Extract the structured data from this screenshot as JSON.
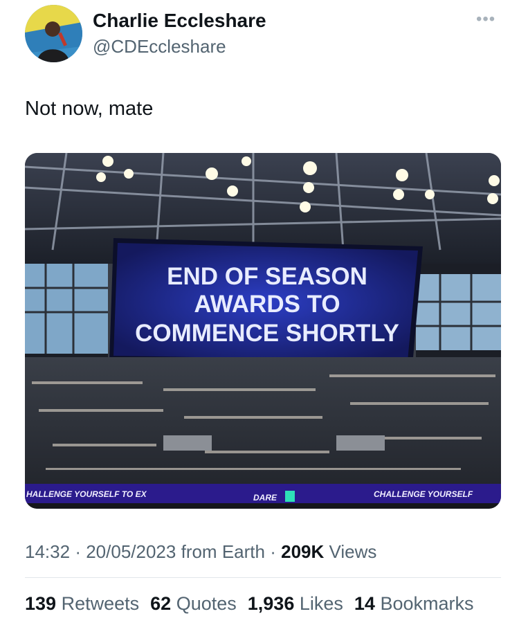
{
  "author": {
    "name": "Charlie Eccleshare",
    "handle": "@CDEccleshare"
  },
  "more_icon": "more-horizontal-icon",
  "more_glyph": "•••",
  "tweet": {
    "text": "Not now, mate"
  },
  "media": {
    "screen_lines": [
      "END OF SEASON",
      "AWARDS TO",
      "COMMENCE SHORTLY"
    ],
    "board_left": "HALLENGE YOURSELF TO EX",
    "board_center": "DARE",
    "board_right": "CHALLENGE YOURSELF"
  },
  "meta": {
    "time": "14:32",
    "date": "20/05/2023",
    "source": "from Earth",
    "views_count": "209K",
    "views_label": "Views"
  },
  "stats": [
    {
      "count": "139",
      "label": "Retweets"
    },
    {
      "count": "62",
      "label": "Quotes"
    },
    {
      "count": "1,936",
      "label": "Likes"
    },
    {
      "count": "14",
      "label": "Bookmarks"
    }
  ],
  "colors": {
    "text": "#0f1419",
    "secondary": "#536471",
    "screen_blue": "#1a237e",
    "board_purple": "#3a1f9e"
  }
}
